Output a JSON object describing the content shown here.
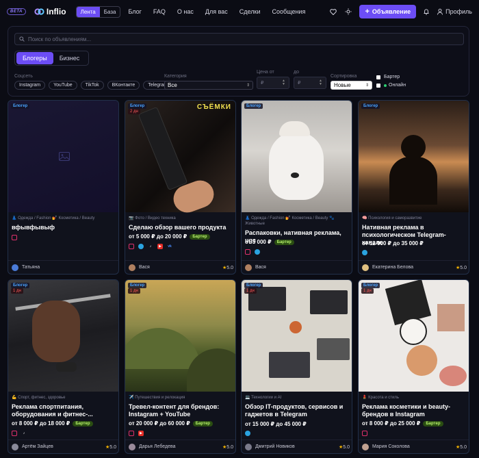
{
  "header": {
    "beta": "BETA",
    "logo": "Inflio",
    "view_switch": [
      "Лента",
      "База"
    ],
    "nav": [
      "Блог",
      "FAQ",
      "О нас",
      "Для вас",
      "Сделки",
      "Сообщения"
    ],
    "ad_button": "Объявление",
    "profile": "Профиль"
  },
  "filters": {
    "search_placeholder": "Поиск по объявлениям...",
    "tabs": [
      "Блогеры",
      "Бизнес"
    ],
    "social_label": "Соцсеть",
    "socials": [
      "Instagram",
      "YouTube",
      "TikTok",
      "ВКонтакте",
      "Telegram"
    ],
    "category_label": "Категория",
    "category_value": "Все",
    "price_from_label": "Цена от",
    "price_to_label": "до",
    "currency": "₽",
    "sort_label": "Сортировка",
    "sort_value": "Новые",
    "barter_label": "Бартер",
    "online_label": "Онлайн"
  },
  "cards": [
    {
      "badge": "Блогер",
      "days": "",
      "cats": "👗 Одежда / Fashion  💅 Косметика / Beauty",
      "title": "вфывфывыф",
      "price": "",
      "barter": "",
      "socials": [
        "instagram"
      ],
      "author": "Татьяна",
      "rating": "",
      "avatar_color": "#4a7bd8"
    },
    {
      "badge": "Блогер",
      "days": "2 дн",
      "cats": "📷 Фото / Видео техника",
      "title": "Сделаю обзор вашего продукта",
      "price": "от 5 000 ₽ до 20 000 ₽",
      "barter": "Бартер",
      "socials": [
        "instagram",
        "telegram",
        "tiktok",
        "youtube",
        "vk"
      ],
      "author": "Вася",
      "rating": "5.0",
      "avatar_color": "#b08060",
      "overlay": "СЪЁМКИ"
    },
    {
      "badge": "Блогер",
      "days": "",
      "cats": "👗 Одежда / Fashion  💅 Косметика / Beauty  🐾 Животные",
      "title": "Распаковки, нативная реклама, ugc",
      "price": "от 3 000 ₽",
      "barter": "Бартер",
      "socials": [
        "instagram",
        "telegram"
      ],
      "author": "Вася",
      "rating": "",
      "avatar_color": "#b08060"
    },
    {
      "badge": "Блогер",
      "days": "",
      "cats": "🧠 Психология и саморазвитие",
      "title": "Нативная реклама в психологическом Telegram-канале",
      "price": "от 12 000 ₽ до 35 000 ₽",
      "barter": "",
      "socials": [
        "telegram"
      ],
      "author": "Екатерина Белова",
      "rating": "5.0",
      "avatar_color": "#e0c080"
    },
    {
      "badge": "Блогер",
      "days": "1 дн",
      "cats": "💪 Спорт, фитнес, здоровье",
      "title": "Реклама спортпитания, оборудования и фитнес-...",
      "price": "от 8 000 ₽ до 18 000 ₽",
      "barter": "Бартер",
      "socials": [
        "instagram",
        "tiktok"
      ],
      "author": "Артём Зайцев",
      "rating": "5.0",
      "avatar_color": "#8a8a9a"
    },
    {
      "badge": "Блогер",
      "days": "1 дн",
      "cats": "✈️ Путешествия и релокация",
      "title": "Тревел-контент для брендов: Instagram + YouTube",
      "price": "от 20 000 ₽ до 60 000 ₽",
      "barter": "Бартер",
      "socials": [
        "instagram",
        "youtube"
      ],
      "author": "Дарья Лебедева",
      "rating": "5.0",
      "avatar_color": "#9a8a9a"
    },
    {
      "badge": "Блогер",
      "days": "1 дн",
      "cats": "💻 Технологии и AI",
      "title": "Обзор IT-продуктов, сервисов и гаджетов в Telegram",
      "price": "от 15 000 ₽ до 45 000 ₽",
      "barter": "",
      "socials": [
        "telegram"
      ],
      "author": "Дмитрий Новиков",
      "rating": "5.0",
      "avatar_color": "#7a7a8a"
    },
    {
      "badge": "Блогер",
      "days": "1 дн",
      "cats": "💄 Красота и стиль",
      "title": "Реклама косметики и beauty-брендов в Instagram",
      "price": "от 8 000 ₽ до 25 000 ₽",
      "barter": "Бартер",
      "socials": [
        "instagram"
      ],
      "author": "Мария Соколова",
      "rating": "5.0",
      "avatar_color": "#c0a090"
    }
  ]
}
